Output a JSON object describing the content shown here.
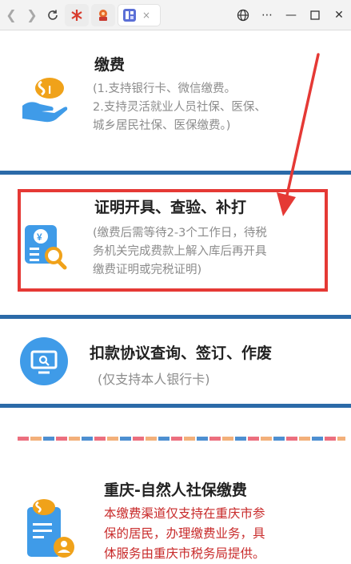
{
  "browser": {
    "tab1_icon": "asterisk-logo-icon",
    "tab2_icon": "badge-logo-icon",
    "tab3_icon": "site-logo-icon",
    "tab_close": "×"
  },
  "sections": [
    {
      "title": "缴费",
      "lines": [
        "(1.支持银行卡、微信缴费。",
        "2.支持灵活就业人员社保、医保、",
        "城乡居民社保、医保缴费。)"
      ]
    },
    {
      "title": "证明开具、查验、补打",
      "lines": [
        "(缴费后需等待2-3个工作日，待税",
        "务机关完成费款上解入库后再开具",
        "缴费证明或完税证明)"
      ]
    },
    {
      "title": "扣款协议查询、签订、作废",
      "lines": [
        "(仅支持本人银行卡)"
      ]
    },
    {
      "title": "重庆-自然人社保缴费",
      "lines": [
        "本缴费渠道仅支持在重庆市参",
        "保的居民，办理缴费业务，具",
        "体服务由重庆市税务局提供。"
      ]
    }
  ],
  "colors": {
    "accent_blue": "#2b6aa8",
    "highlight_red": "#e53935",
    "notice_red": "#c82a2a",
    "icon_blue": "#3f9be8",
    "icon_orange": "#f0a21a"
  }
}
